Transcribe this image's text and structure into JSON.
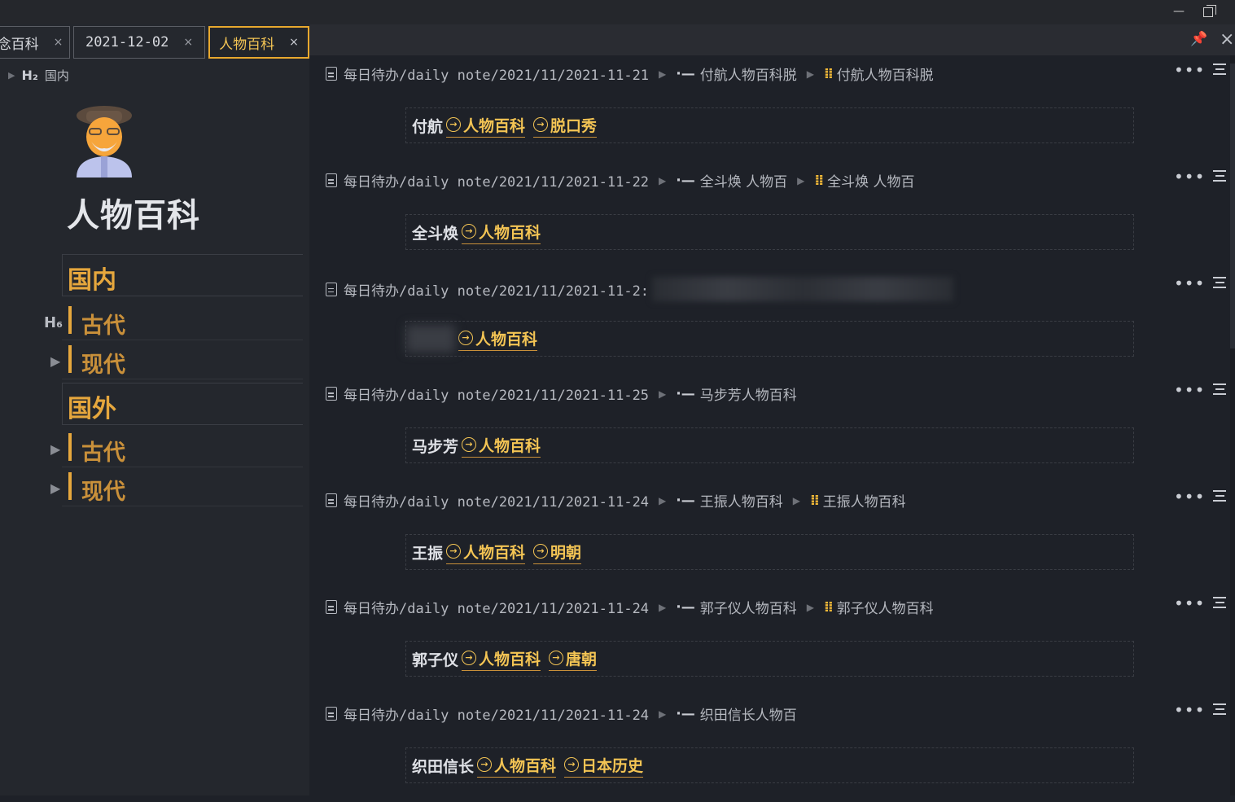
{
  "tabs": [
    {
      "label": "念百科",
      "close": "×"
    },
    {
      "label": "2021-12-02",
      "close": "×"
    },
    {
      "label": "人物百科",
      "close": "×"
    }
  ],
  "window": {
    "minimize": "—"
  },
  "outline": {
    "heading_marker": "H₂",
    "heading_label": "国内",
    "h6_marker": "H₆"
  },
  "page": {
    "title": "人物百科",
    "sections": [
      {
        "label": "国内",
        "children": [
          "古代",
          "现代"
        ]
      },
      {
        "label": "国外",
        "children": [
          "古代",
          "现代"
        ]
      }
    ]
  },
  "header": {
    "pin_icon": "pin-icon",
    "close": "×"
  },
  "entries": [
    {
      "path": "每日待办/daily note/2021/11/2021-11-21",
      "crumbs": [
        "付航人物百科脱",
        "付航人物百科脱"
      ],
      "name": "付航",
      "links": [
        "人物百科",
        "脱口秀"
      ]
    },
    {
      "path": "每日待办/daily note/2021/11/2021-11-22",
      "crumbs": [
        "全斗焕 人物百",
        "全斗焕 人物百"
      ],
      "name": "全斗焕",
      "links": [
        "人物百科"
      ]
    },
    {
      "path": "每日待办/daily note/2021/11/2021-11-2:",
      "crumbs": [],
      "name": "",
      "links": [
        "人物百科"
      ]
    },
    {
      "path": "每日待办/daily note/2021/11/2021-11-25",
      "crumbs": [
        "马步芳人物百科"
      ],
      "name": "马步芳",
      "links": [
        "人物百科"
      ]
    },
    {
      "path": "每日待办/daily note/2021/11/2021-11-24",
      "crumbs": [
        "王振人物百科",
        "王振人物百科"
      ],
      "name": "王振",
      "links": [
        "人物百科",
        "明朝"
      ]
    },
    {
      "path": "每日待办/daily note/2021/11/2021-11-24",
      "crumbs": [
        "郭子仪人物百科",
        "郭子仪人物百科"
      ],
      "name": "郭子仪",
      "links": [
        "人物百科",
        "唐朝"
      ]
    },
    {
      "path": "每日待办/daily note/2021/11/2021-11-24",
      "crumbs": [
        "织田信长人物百"
      ],
      "name": "织田信长",
      "links": [
        "人物百科",
        "日本历史"
      ]
    }
  ],
  "colors": {
    "accent": "#f3c454",
    "section": "#e6a73d",
    "background": "#1e2128",
    "sidebar": "#24272d"
  }
}
